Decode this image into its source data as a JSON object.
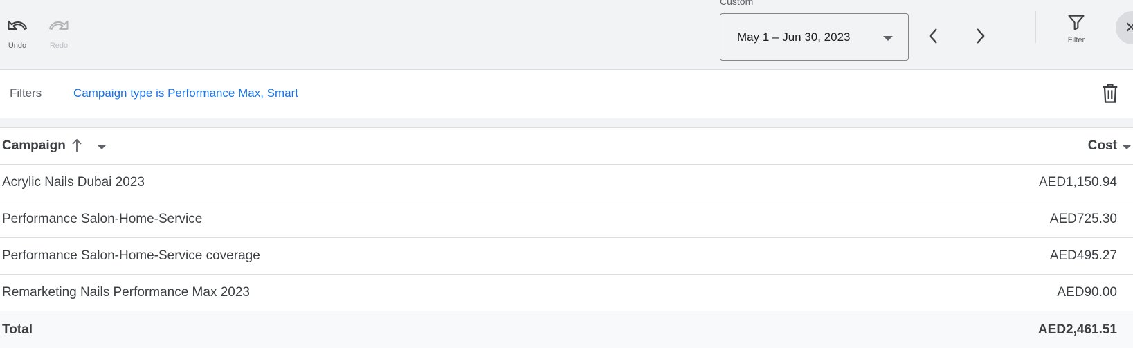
{
  "toolbar": {
    "undo_label": "Undo",
    "redo_label": "Redo",
    "date_caption": "Custom",
    "date_range": "May 1 – Jun 30, 2023",
    "filter_label": "Filter"
  },
  "filters": {
    "label": "Filters",
    "active_filter": "Campaign type is Performance Max, Smart"
  },
  "table": {
    "columns": {
      "campaign": "Campaign",
      "cost": "Cost"
    },
    "rows": [
      {
        "campaign": "Acrylic Nails Dubai 2023",
        "cost": "AED1,150.94"
      },
      {
        "campaign": "Performance Salon-Home-Service",
        "cost": "AED725.30"
      },
      {
        "campaign": "Performance Salon-Home-Service coverage",
        "cost": "AED495.27"
      },
      {
        "campaign": "Remarketing Nails Performance Max 2023",
        "cost": "AED90.00"
      }
    ],
    "total": {
      "label": "Total",
      "cost": "AED2,461.51"
    }
  },
  "colors": {
    "accent": "#1a73e8",
    "text": "#3c4043",
    "border": "#dadce0",
    "toolbar_bg": "#f1f3f4"
  }
}
